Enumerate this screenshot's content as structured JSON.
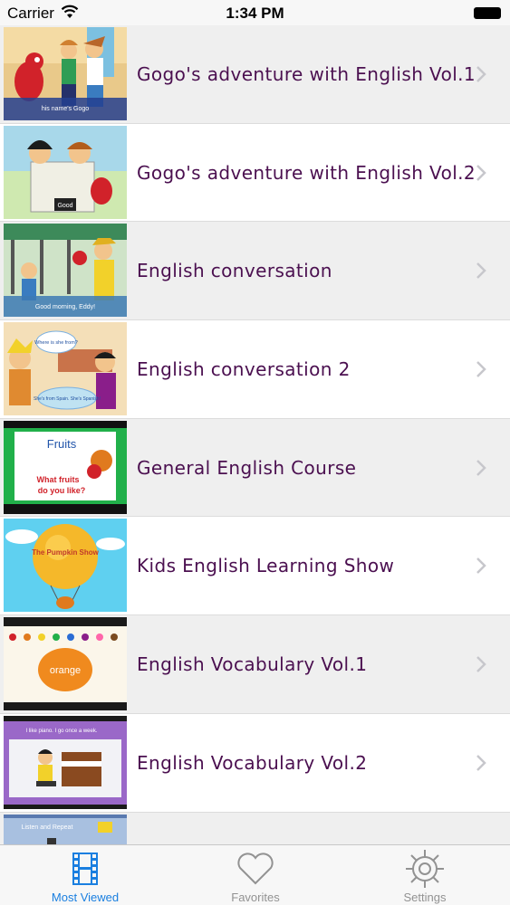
{
  "status_bar": {
    "carrier": "Carrier",
    "time": "1:34 PM"
  },
  "colors": {
    "title_text": "#4b1050",
    "tab_active": "#1a7fe0",
    "tab_inactive": "#929292",
    "row_alt": "#efefef"
  },
  "list": {
    "items": [
      {
        "title": "Gogo's adventure with English Vol.1",
        "thumbnail": "gogo-vol1-cartoon"
      },
      {
        "title": "Gogo's adventure with English Vol.2",
        "thumbnail": "gogo-vol2-cartoon"
      },
      {
        "title": "English conversation",
        "thumbnail": "conversation-cartoon"
      },
      {
        "title": "English conversation 2",
        "thumbnail": "conversation2-cartoon"
      },
      {
        "title": "General English Course",
        "thumbnail": "fruits-course"
      },
      {
        "title": "Kids English Learning Show",
        "thumbnail": "balloon-show"
      },
      {
        "title": "English Vocabulary Vol.1",
        "thumbnail": "orange-vocabulary"
      },
      {
        "title": "English Vocabulary Vol.2",
        "thumbnail": "piano-vocabulary"
      },
      {
        "title": "",
        "thumbnail": "listen-and-repeat"
      }
    ],
    "thumbnail_captions": {
      "gogo_vol1": "his name's Gogo",
      "gogo_vol2": "Good",
      "conversation": "Good morning, Eddy!",
      "conversation2_q": "Where is she from?",
      "conversation2_a": "She's from Spain. She's Spanish!",
      "fruits_title": "Fruits",
      "fruits_q1": "What fruits",
      "fruits_q2": "do you like?",
      "balloon": "The Pumpkin Show",
      "orange": "orange",
      "piano": "I like piano. I go once a week.",
      "listen": "Listen and Repeat"
    }
  },
  "tab_bar": {
    "tabs": [
      {
        "label": "Most Viewed",
        "icon": "film-strip-icon",
        "active": true
      },
      {
        "label": "Favorites",
        "icon": "heart-icon",
        "active": false
      },
      {
        "label": "Settings",
        "icon": "gear-icon",
        "active": false
      }
    ]
  }
}
